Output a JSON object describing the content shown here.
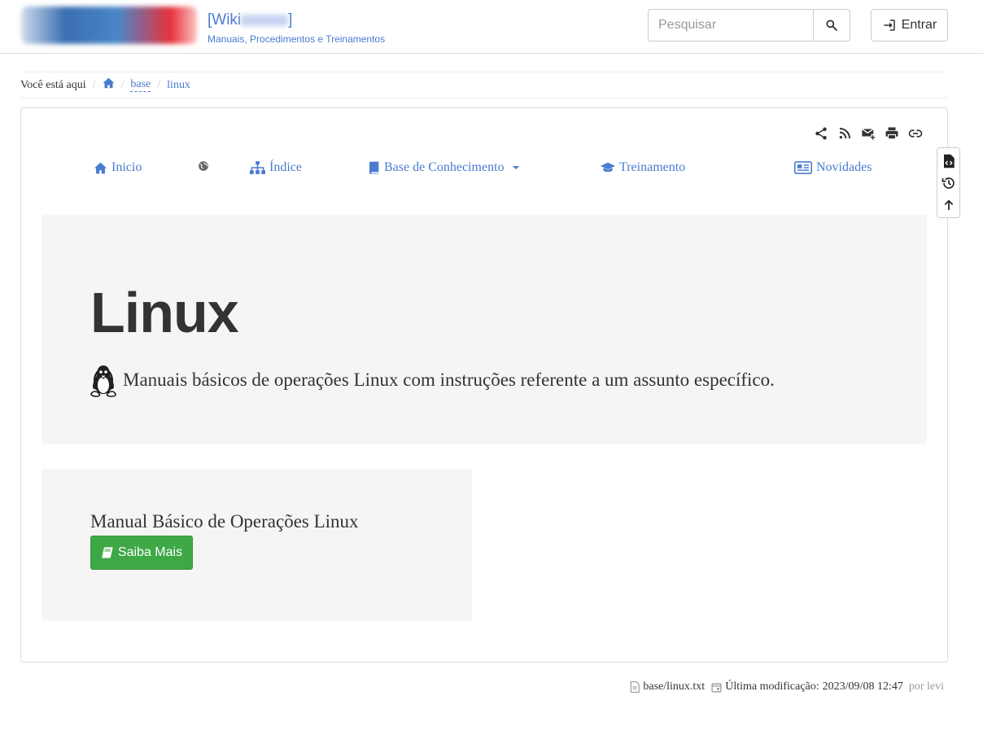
{
  "header": {
    "title_prefix": "[Wiki",
    "title_suffix": "]",
    "subtitle": "Manuais, Procedimentos e Treinamentos",
    "search": {
      "placeholder": "Pesquisar",
      "value": ""
    },
    "login_label": "Entrar"
  },
  "breadcrumb": {
    "label": "Você está aqui",
    "items": [
      {
        "label": "base"
      },
      {
        "label": "linux"
      }
    ]
  },
  "page_tools": [
    "share-icon",
    "rss-icon",
    "email-icon",
    "print-icon",
    "link-icon"
  ],
  "nav": {
    "items": [
      {
        "label": "Inicio",
        "icon": "home-icon"
      },
      {
        "label": "",
        "icon": "globe-icon"
      },
      {
        "label": "Índice",
        "icon": "sitemap-icon"
      },
      {
        "label": "Base de Conhecimento",
        "icon": "book-icon",
        "dropdown": true
      },
      {
        "label": "Treinamento",
        "icon": "graduation-cap-icon"
      },
      {
        "label": "Novidades",
        "icon": "newspaper-icon"
      }
    ]
  },
  "jumbotron": {
    "title": "Linux",
    "lead": "Manuais básicos de operações Linux com instruções referente a um assunto específico.",
    "lead_icon": "tux-icon"
  },
  "card": {
    "title": "Manual Básico de Operações Linux",
    "button_label": "Saiba Mais",
    "button_color": "#3ea846"
  },
  "side_tools": [
    "file-source-icon",
    "history-icon",
    "back-to-top-icon"
  ],
  "footer": {
    "file": "base/linux.txt",
    "modified_label": "Última modificação:",
    "modified_date": "2023/09/08 12:47",
    "author": "por levi"
  },
  "colors": {
    "link": "#4a7bd0",
    "text": "#333333",
    "panel_bg": "#f5f5f5",
    "success": "#3ea846"
  }
}
